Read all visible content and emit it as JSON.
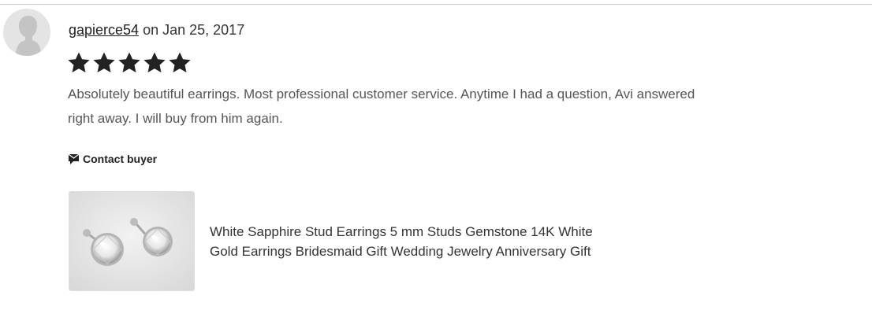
{
  "review": {
    "username": "gapierce54",
    "date_text": "on Jan 25, 2017",
    "rating": 5,
    "rating_max": 5,
    "text": "Absolutely beautiful earrings. Most professional customer service. Anytime I had a question, Avi answered right away. I will buy from him again.",
    "contact_label": "Contact buyer"
  },
  "listing": {
    "title": "White Sapphire Stud Earrings 5 mm Studs Gemstone 14K White Gold Earrings Bridesmaid Gift Wedding Jewelry Anniversary Gift",
    "image_icon": "earrings-photo"
  },
  "colors": {
    "star": "#222222",
    "text_muted": "#555555",
    "divider": "#c8c8c8"
  }
}
